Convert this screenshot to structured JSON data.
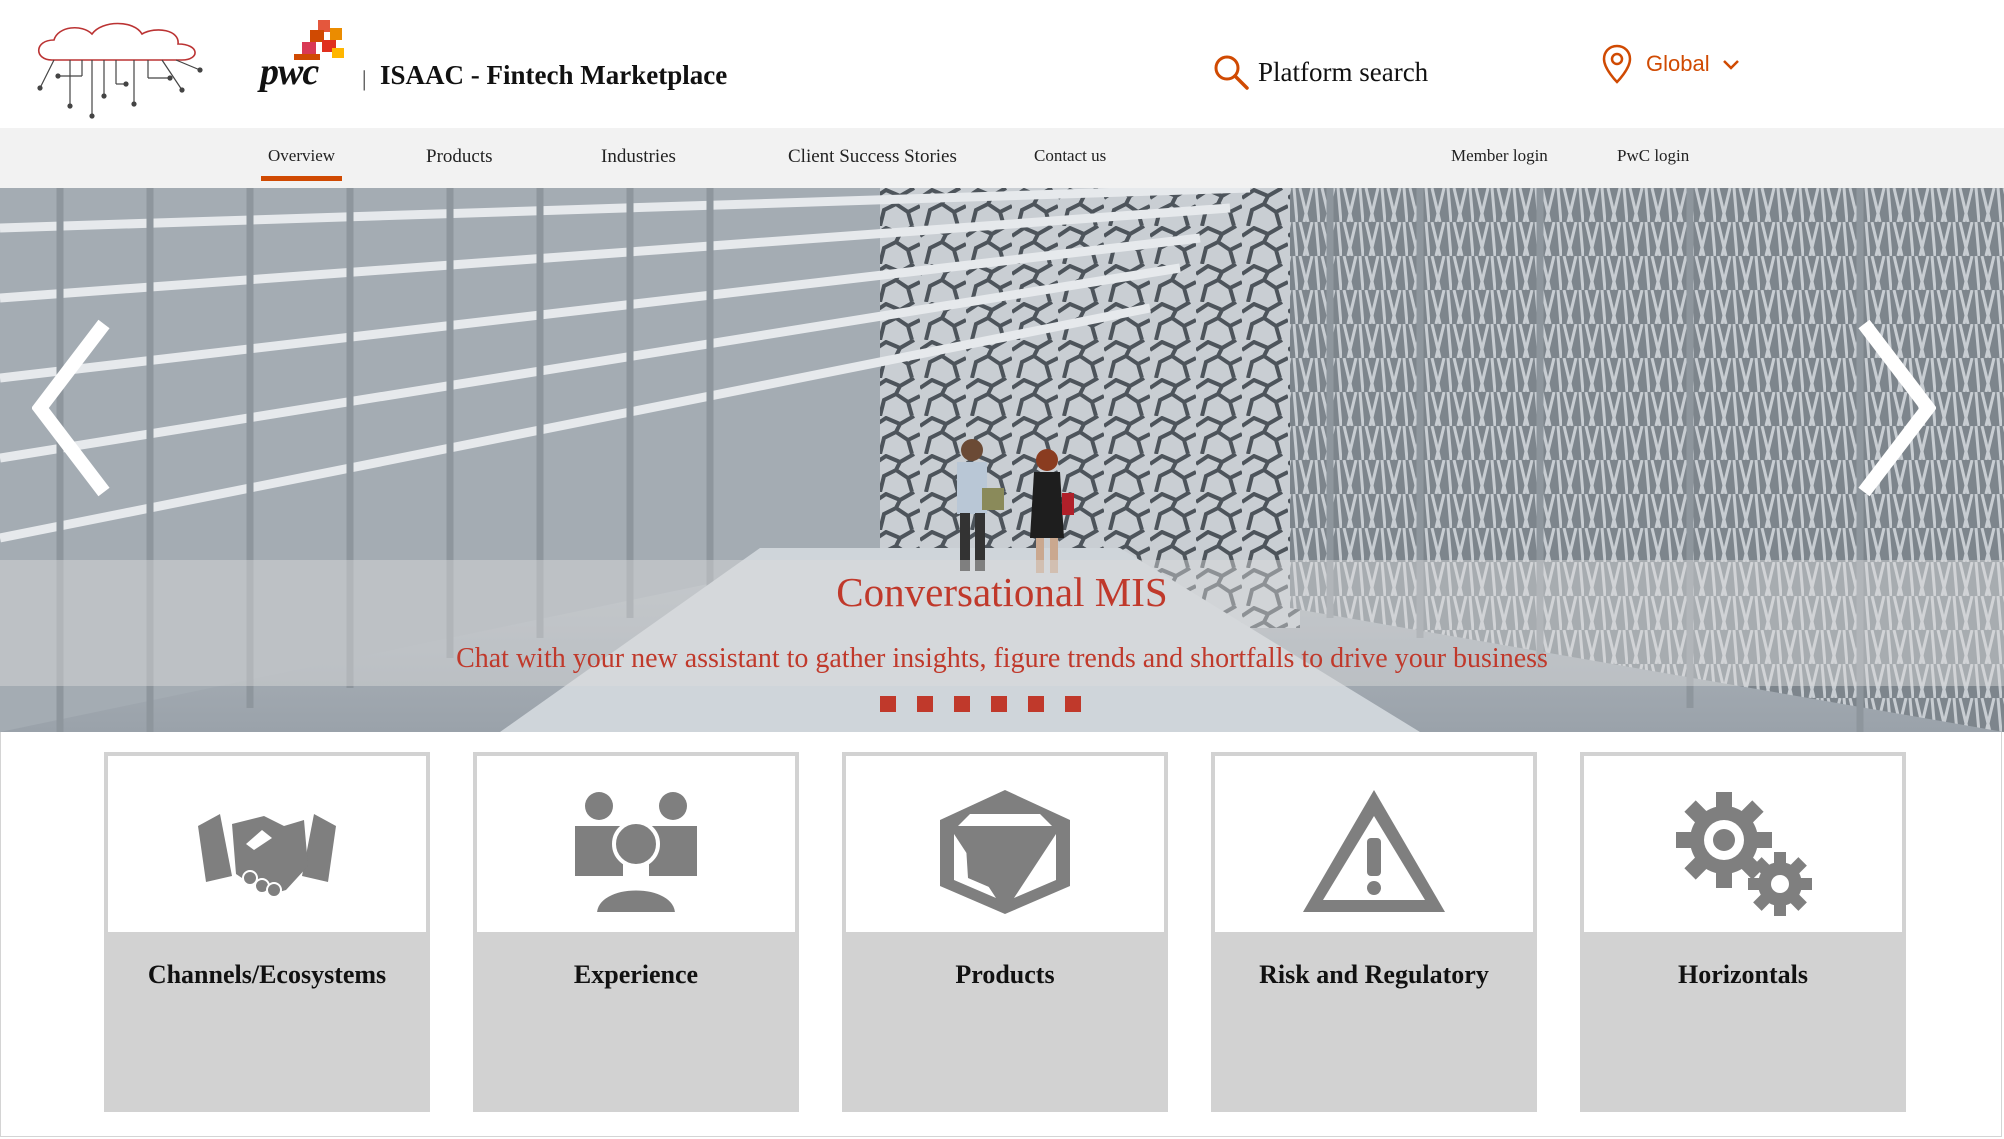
{
  "header": {
    "logo_text": "pwc",
    "title": "ISAAC - Fintech Marketplace",
    "search_label": "Platform search",
    "region_label": "Global",
    "accent_color": "#d04a02"
  },
  "nav": {
    "items": [
      {
        "label": "Overview",
        "active": true
      },
      {
        "label": "Products"
      },
      {
        "label": "Industries"
      },
      {
        "label": "Client Success Stories"
      },
      {
        "label": "Contact us"
      }
    ],
    "logins": [
      {
        "label": "Member login"
      },
      {
        "label": "PwC login"
      }
    ]
  },
  "hero": {
    "title": "Conversational MIS",
    "subtitle": "Chat with your new assistant to gather insights, figure trends and shortfalls to drive your business",
    "slide_count": 6,
    "caption_color": "#c0392b"
  },
  "cards": [
    {
      "label": "Channels/Ecosystems",
      "icon": "handshake-icon"
    },
    {
      "label": "Experience",
      "icon": "people-group-icon"
    },
    {
      "label": "Products",
      "icon": "cube-box-icon"
    },
    {
      "label": "Risk and Regulatory",
      "icon": "warning-triangle-icon"
    },
    {
      "label": "Horizontals",
      "icon": "gears-icon"
    }
  ]
}
